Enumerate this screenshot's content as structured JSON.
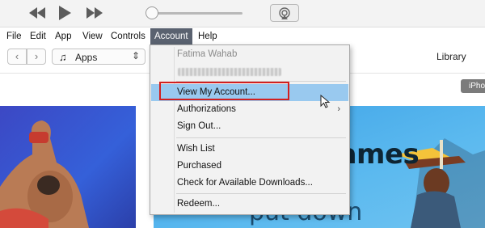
{
  "player": {
    "controls": [
      "previous-icon",
      "play-icon",
      "next-icon",
      "airplay-icon"
    ]
  },
  "menubar": {
    "items": [
      {
        "label": "File"
      },
      {
        "label": "Edit"
      },
      {
        "label": "App"
      },
      {
        "label": "View"
      },
      {
        "label": "Controls"
      },
      {
        "label": "Account"
      },
      {
        "label": "Help"
      }
    ],
    "active": "Account"
  },
  "toolbar": {
    "back": "‹",
    "forward": "›",
    "media_icon": "♫",
    "media_selection": "Apps",
    "library": "Library",
    "device": "iPho"
  },
  "content": {
    "headline": "us games",
    "subline": "put down"
  },
  "account_menu": {
    "user_name": "Fatima Wahab",
    "items": [
      {
        "label": "View My Account...",
        "highlighted": true
      },
      {
        "label": "Authorizations",
        "submenu": true
      },
      {
        "label": "Sign Out..."
      },
      {
        "label": "Wish List"
      },
      {
        "label": "Purchased"
      },
      {
        "label": "Check for Available Downloads..."
      },
      {
        "label": "Redeem..."
      }
    ],
    "submenu_arrow": "›"
  },
  "colors": {
    "menubar_active": "#5a6270",
    "menu_highlight": "#99c9ef",
    "callout_border": "#d21f1f",
    "banner_left": "#3c48c4",
    "banner_right": "#3aa0e6"
  }
}
